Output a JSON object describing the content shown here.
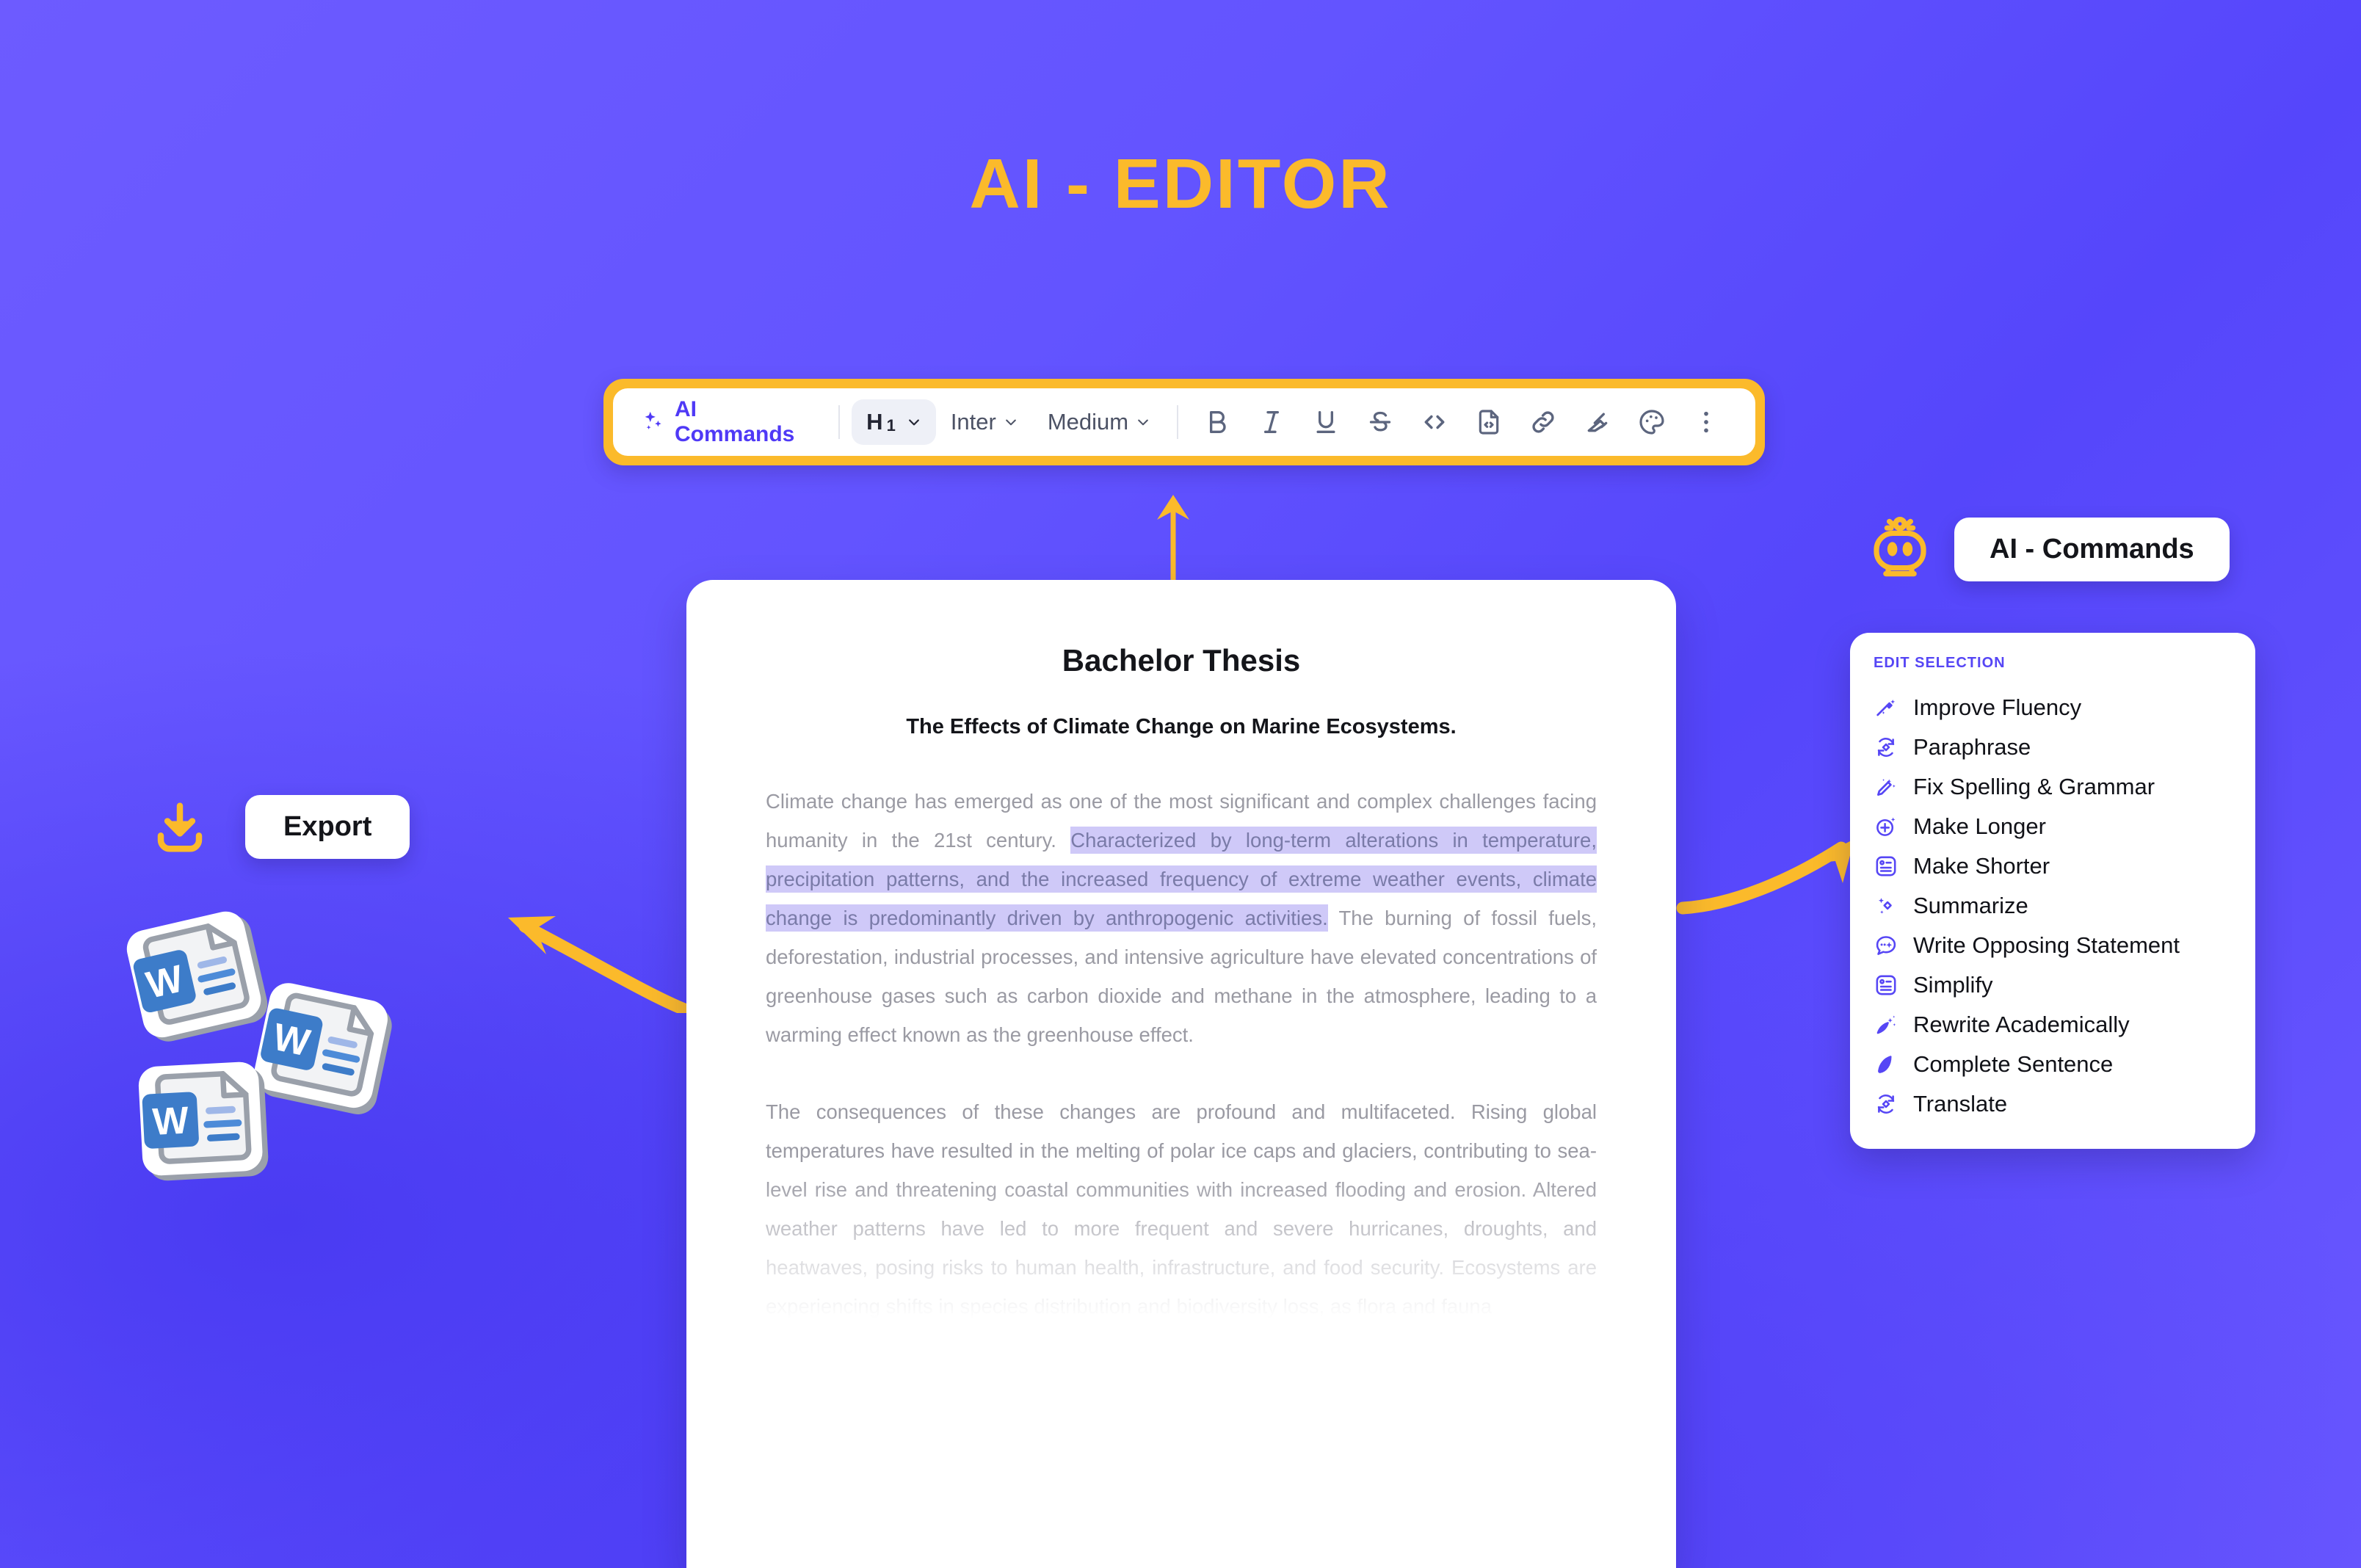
{
  "page": {
    "title": "AI - EDITOR",
    "accent_yellow": "#FBBA2B",
    "accent_purple": "#5646F5",
    "background_from": "#6D5BFF",
    "background_to": "#4A3BF2"
  },
  "toolbar": {
    "ai_commands_label": "AI Commands",
    "ai_commands_icon": "sparkles-icon",
    "heading_label": "H",
    "heading_level": "1",
    "font_family_label": "Inter",
    "font_weight_label": "Medium",
    "icons": [
      {
        "name": "bold-icon",
        "glyph": "B"
      },
      {
        "name": "italic-icon",
        "glyph": "I"
      },
      {
        "name": "underline-icon",
        "glyph": "U"
      },
      {
        "name": "strikethrough-icon",
        "glyph": "S"
      },
      {
        "name": "code-icon",
        "glyph": "<>"
      },
      {
        "name": "code-block-file-icon",
        "glyph": "file-code"
      },
      {
        "name": "link-icon",
        "glyph": "link"
      },
      {
        "name": "highlighter-icon",
        "glyph": "marker"
      },
      {
        "name": "color-palette-icon",
        "glyph": "palette"
      },
      {
        "name": "more-options-icon",
        "glyph": "kebab"
      }
    ]
  },
  "document": {
    "title": "Bachelor Thesis",
    "subtitle": "The Effects of Climate Change on Marine Ecosystems.",
    "paragraph1_before": "Climate change has emerged as one of the most significant and complex challenges facing humanity in the 21st century. ",
    "paragraph1_highlight": "Characterized by long-term alterations in temperature, precipitation patterns, and the increased frequency of extreme weather events, climate change is predominantly driven by anthropogenic activities.",
    "paragraph1_after": " The burning of fossil fuels, deforestation, industrial processes, and intensive agriculture have elevated concentrations of greenhouse gases such as carbon dioxide and methane in the atmosphere, leading to a warming effect known as the greenhouse effect.",
    "paragraph2": "The consequences of these changes are profound and multifaceted. Rising global temperatures have resulted in the melting of polar ice caps and glaciers, contributing to sea-level rise and threatening coastal communities with increased flooding and erosion. Altered weather patterns have led to more frequent and severe hurricanes, droughts, and heatwaves, posing risks to human health, infrastructure, and food security. Ecosystems are experiencing shifts in species distribution and biodiversity loss, as flora and fauna",
    "highlight_color": "#CFC9F8"
  },
  "export": {
    "label": "Export",
    "download_icon": "download-icon",
    "file_icons": [
      {
        "name": "word-document-icon",
        "letter": "W"
      },
      {
        "name": "word-document-icon",
        "letter": "W"
      },
      {
        "name": "word-document-icon",
        "letter": "W"
      }
    ]
  },
  "ai_commands": {
    "header_label": "AI - Commands",
    "header_icon": "robot-icon",
    "section_label": "EDIT SELECTION",
    "items": [
      {
        "label": "Improve Fluency",
        "icon": "magic-wand-icon"
      },
      {
        "label": "Paraphrase",
        "icon": "refresh-diamond-icon"
      },
      {
        "label": "Fix Spelling & Grammar",
        "icon": "magic-pencil-icon"
      },
      {
        "label": "Make Longer",
        "icon": "plus-circle-sparkle-icon"
      },
      {
        "label": "Make Shorter",
        "icon": "list-square-icon"
      },
      {
        "label": "Summarize",
        "icon": "sparkles-icon"
      },
      {
        "label": "Write Opposing Statement",
        "icon": "chat-bubble-sparkle-icon"
      },
      {
        "label": "Simplify",
        "icon": "list-square-icon"
      },
      {
        "label": "Rewrite Academically",
        "icon": "quill-sparkle-icon"
      },
      {
        "label": "Complete Sentence",
        "icon": "feather-icon"
      },
      {
        "label": "Translate",
        "icon": "refresh-diamond-icon"
      }
    ]
  }
}
